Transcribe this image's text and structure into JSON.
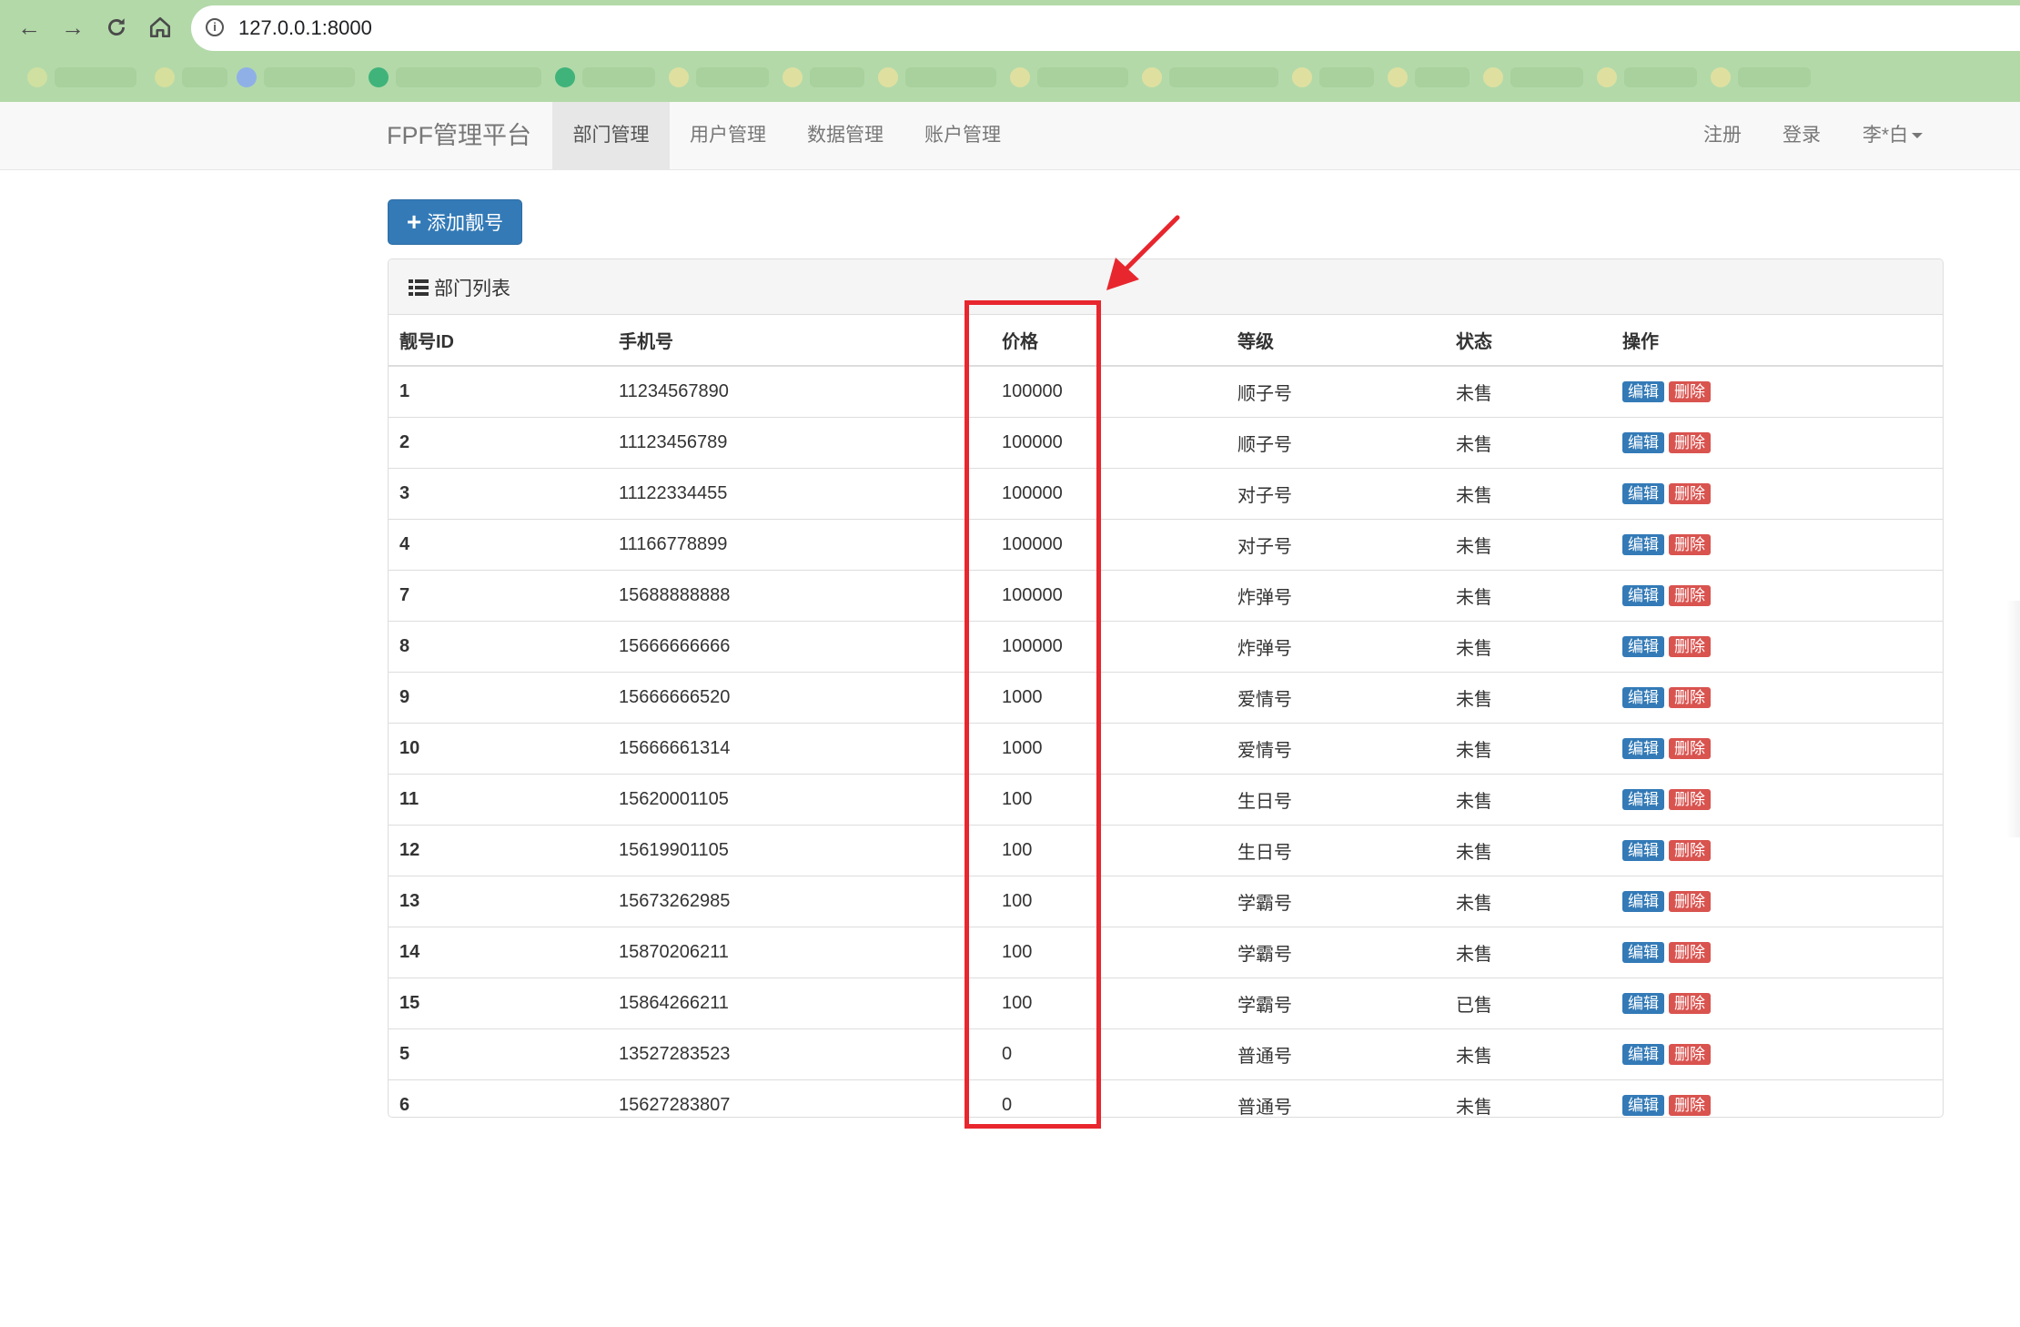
{
  "browser": {
    "url": "127.0.0.1:8000",
    "back_icon": "arrow-left-icon",
    "forward_icon": "arrow-right-icon",
    "reload_icon": "reload-icon",
    "home_icon": "home-icon",
    "chrome_color": "#b3d9a9"
  },
  "navbar": {
    "brand": "FPF管理平台",
    "items": [
      "部门管理",
      "用户管理",
      "数据管理",
      "账户管理"
    ],
    "active_index": 0,
    "right": {
      "register": "注册",
      "login": "登录",
      "user": "李*白"
    }
  },
  "toolbar": {
    "add_label": "添加靓号",
    "add_icon": "plus-icon",
    "primary_color": "#337ab7"
  },
  "panel": {
    "title": "部门列表",
    "title_icon": "list-icon"
  },
  "table": {
    "columns": [
      "靓号ID",
      "手机号",
      "价格",
      "等级",
      "状态",
      "操作"
    ],
    "edit_label": "编辑",
    "delete_label": "删除",
    "rows": [
      {
        "id": "1",
        "mobile": "11234567890",
        "price": "100000",
        "level": "顺子号",
        "status": "未售"
      },
      {
        "id": "2",
        "mobile": "11123456789",
        "price": "100000",
        "level": "顺子号",
        "status": "未售"
      },
      {
        "id": "3",
        "mobile": "11122334455",
        "price": "100000",
        "level": "对子号",
        "status": "未售"
      },
      {
        "id": "4",
        "mobile": "11166778899",
        "price": "100000",
        "level": "对子号",
        "status": "未售"
      },
      {
        "id": "7",
        "mobile": "15688888888",
        "price": "100000",
        "level": "炸弹号",
        "status": "未售"
      },
      {
        "id": "8",
        "mobile": "15666666666",
        "price": "100000",
        "level": "炸弹号",
        "status": "未售"
      },
      {
        "id": "9",
        "mobile": "15666666520",
        "price": "1000",
        "level": "爱情号",
        "status": "未售"
      },
      {
        "id": "10",
        "mobile": "15666661314",
        "price": "1000",
        "level": "爱情号",
        "status": "未售"
      },
      {
        "id": "11",
        "mobile": "15620001105",
        "price": "100",
        "level": "生日号",
        "status": "未售"
      },
      {
        "id": "12",
        "mobile": "15619901105",
        "price": "100",
        "level": "生日号",
        "status": "未售"
      },
      {
        "id": "13",
        "mobile": "15673262985",
        "price": "100",
        "level": "学霸号",
        "status": "未售"
      },
      {
        "id": "14",
        "mobile": "15870206211",
        "price": "100",
        "level": "学霸号",
        "status": "未售"
      },
      {
        "id": "15",
        "mobile": "15864266211",
        "price": "100",
        "level": "学霸号",
        "status": "已售"
      },
      {
        "id": "5",
        "mobile": "13527283523",
        "price": "0",
        "level": "普通号",
        "status": "未售"
      },
      {
        "id": "6",
        "mobile": "15627283807",
        "price": "0",
        "level": "普通号",
        "status": "未售"
      }
    ],
    "edit_color": "#337ab7",
    "delete_color": "#d9534f"
  },
  "annotation": {
    "highlight_color": "#e8262e",
    "highlight_target": "价格"
  }
}
